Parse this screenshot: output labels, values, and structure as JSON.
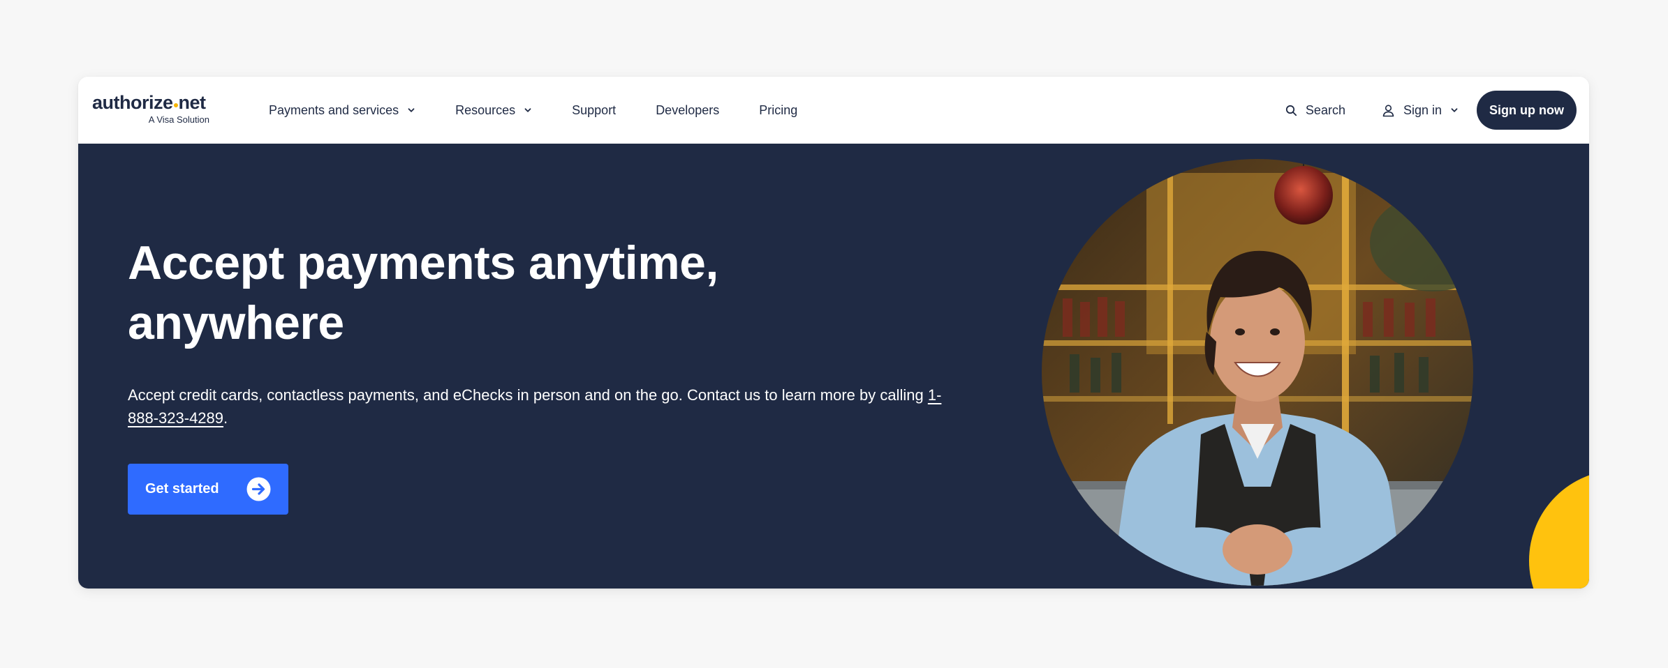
{
  "logo": {
    "word_start": "authorize",
    "word_end": "net",
    "subtitle": "A Visa Solution"
  },
  "nav": {
    "links": [
      {
        "label": "Payments and services",
        "has_dropdown": true
      },
      {
        "label": "Resources",
        "has_dropdown": true
      },
      {
        "label": "Support",
        "has_dropdown": false
      },
      {
        "label": "Developers",
        "has_dropdown": false
      },
      {
        "label": "Pricing",
        "has_dropdown": false
      }
    ],
    "search_label": "Search",
    "signin_label": "Sign in",
    "signup_label": "Sign up now"
  },
  "hero": {
    "title_line1": "Accept payments anytime,",
    "title_line2": "anywhere",
    "text_before": "Accept credit cards, contactless payments, and eChecks in person and on the go. Contact us to learn more by calling ",
    "phone": "1-888-323-4289",
    "text_after": ".",
    "cta_label": "Get started"
  },
  "colors": {
    "navy": "#1f2a44",
    "blue_cta": "#2f6bff",
    "yellow_accent": "#ffc20e",
    "background": "#f7f7f7"
  },
  "icons": {
    "search": "search-icon",
    "user": "user-icon",
    "chevron": "chevron-down-icon",
    "arrow": "arrow-right-circle-icon"
  }
}
